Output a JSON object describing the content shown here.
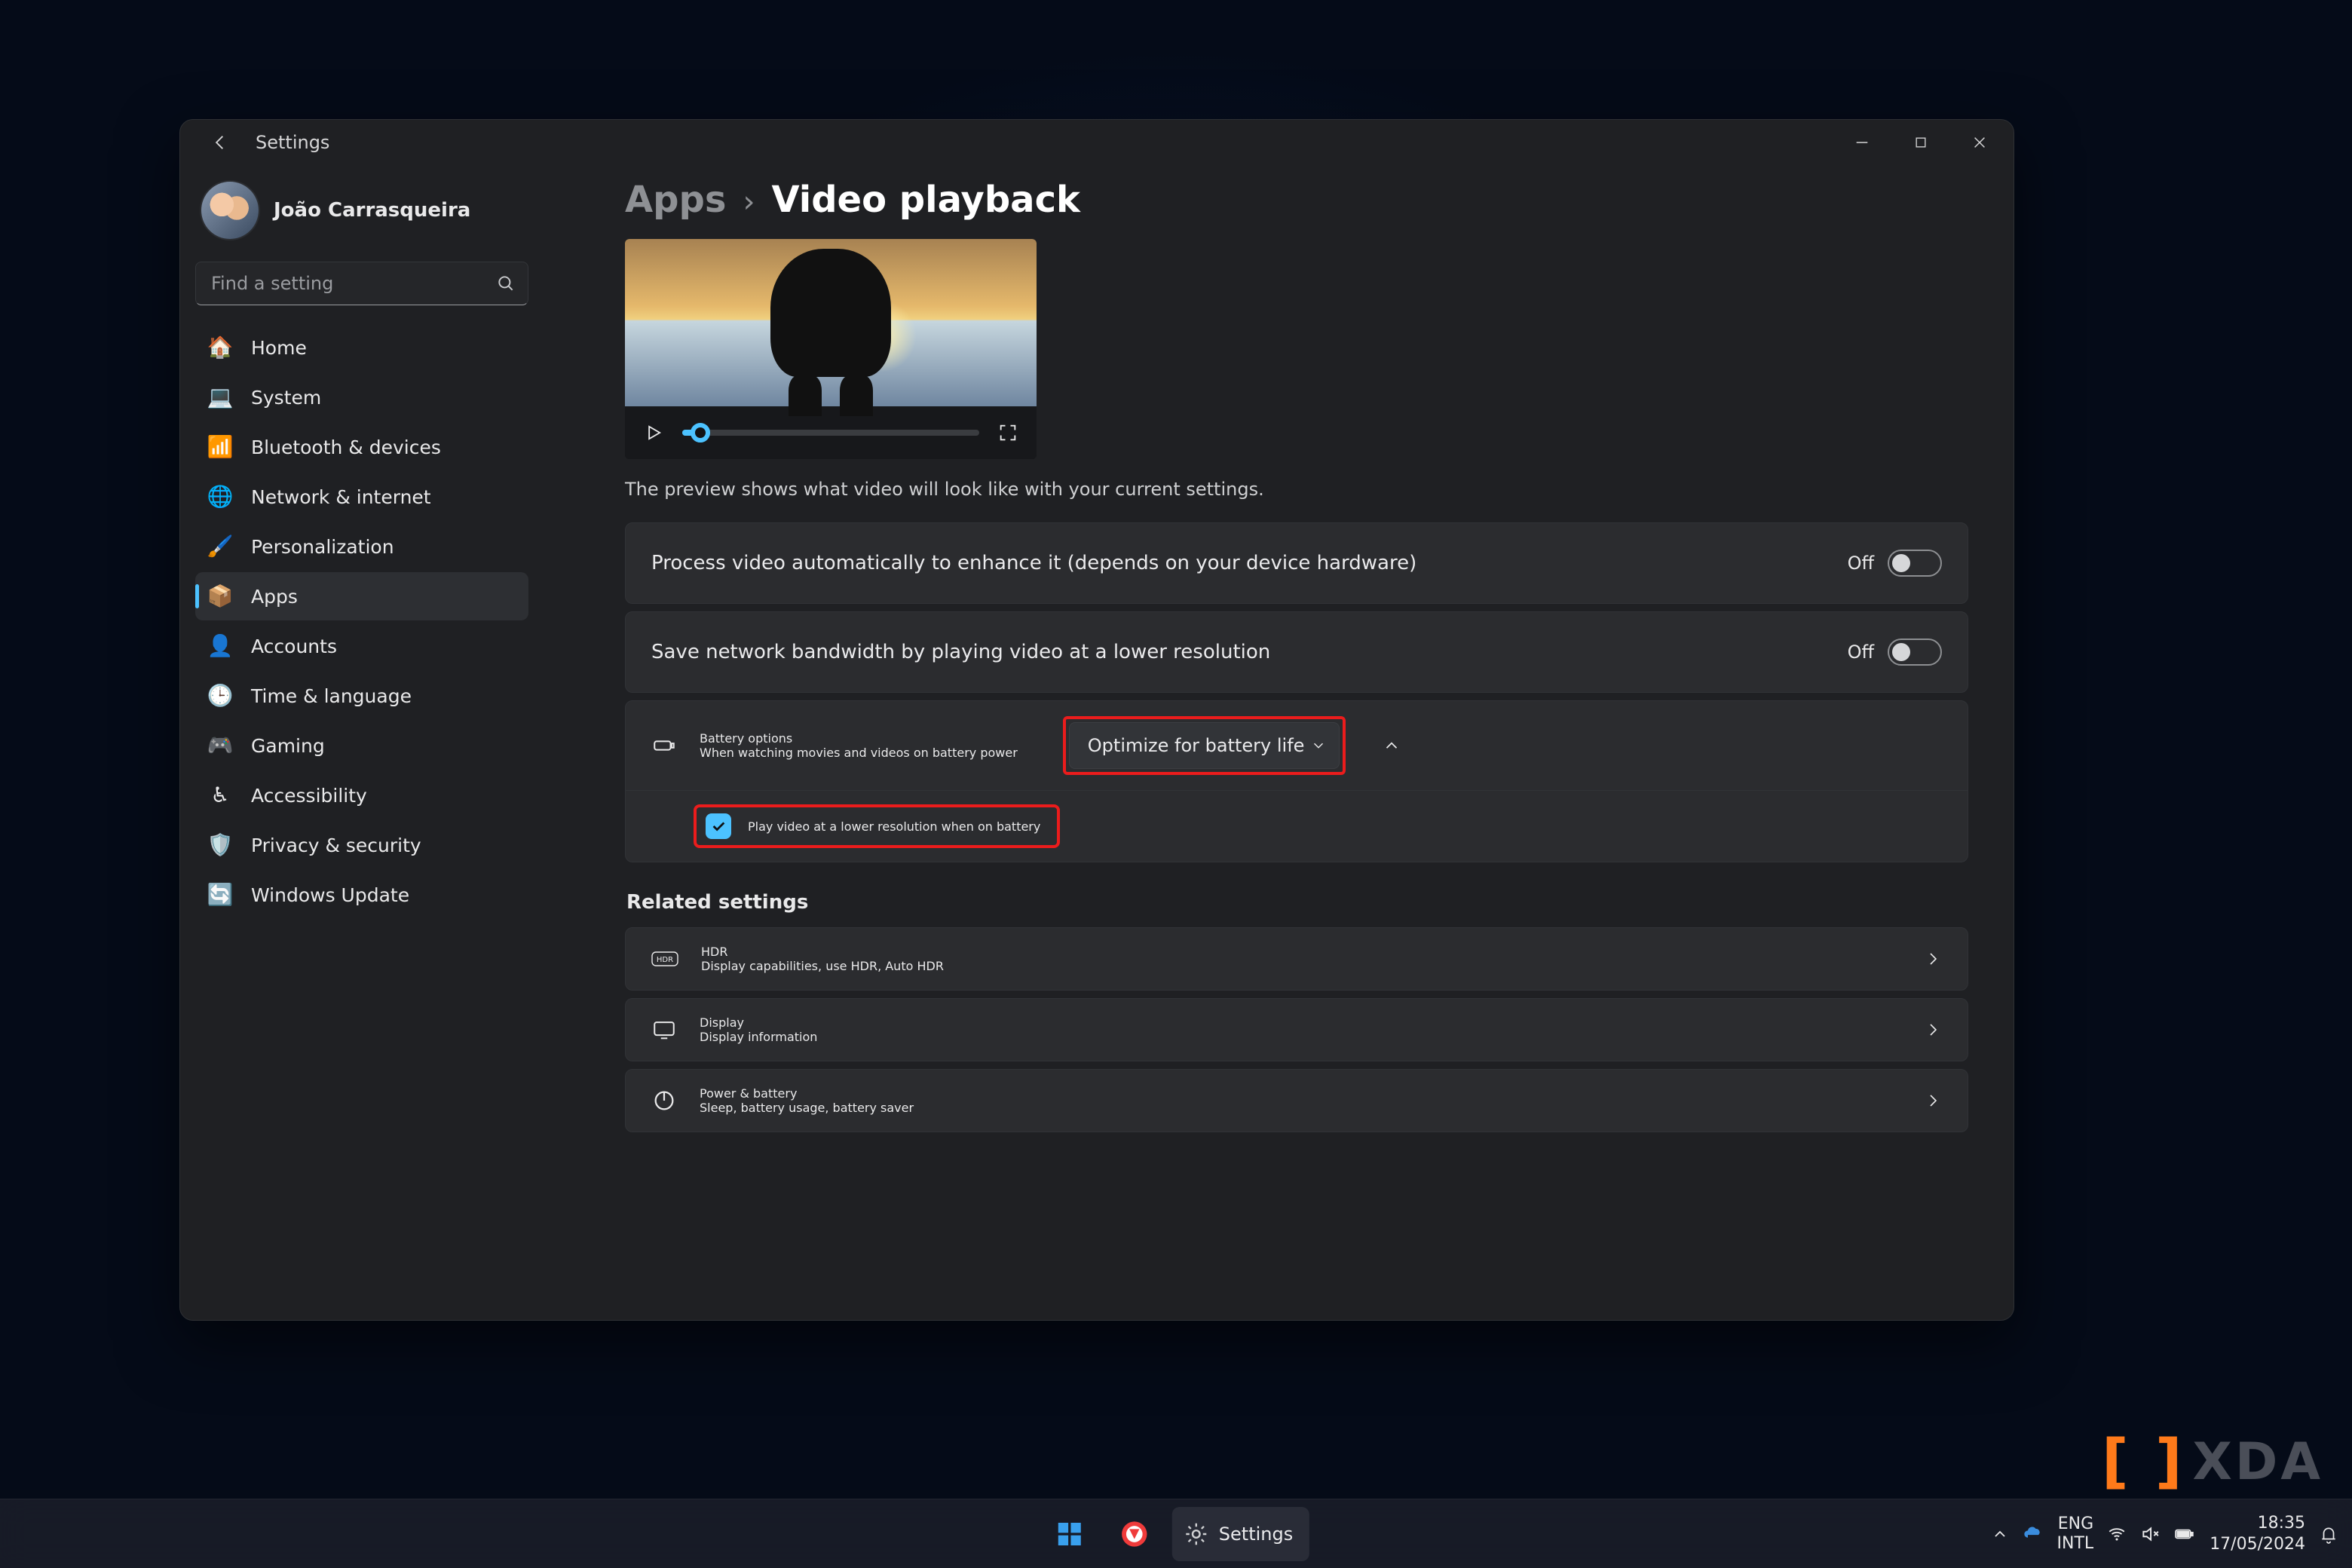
{
  "window": {
    "app_title": "Settings",
    "profile_name": "João Carrasqueira",
    "search_placeholder": "Find a setting"
  },
  "sidebar": {
    "items": [
      {
        "label": "Home",
        "emoji": "🏠"
      },
      {
        "label": "System",
        "emoji": "💻"
      },
      {
        "label": "Bluetooth & devices",
        "emoji": "📶"
      },
      {
        "label": "Network & internet",
        "emoji": "🌐"
      },
      {
        "label": "Personalization",
        "emoji": "🖌️"
      },
      {
        "label": "Apps",
        "emoji": "📦"
      },
      {
        "label": "Accounts",
        "emoji": "👤"
      },
      {
        "label": "Time & language",
        "emoji": "🕒"
      },
      {
        "label": "Gaming",
        "emoji": "🎮"
      },
      {
        "label": "Accessibility",
        "emoji": "♿"
      },
      {
        "label": "Privacy & security",
        "emoji": "🛡️"
      },
      {
        "label": "Windows Update",
        "emoji": "🔄"
      }
    ],
    "active_index": 5
  },
  "main": {
    "breadcrumb_parent": "Apps",
    "breadcrumb_current": "Video playback",
    "preview_caption": "The preview shows what video will look like with your current settings.",
    "toggles": [
      {
        "label": "Process video automatically to enhance it (depends on your device hardware)",
        "state": "Off"
      },
      {
        "label": "Save network bandwidth by playing video at a lower resolution",
        "state": "Off"
      }
    ],
    "battery": {
      "title": "Battery options",
      "subtitle": "When watching movies and videos on battery power",
      "dropdown_value": "Optimize for battery life",
      "checkbox_label": "Play video at a lower resolution when on battery",
      "checkbox_checked": true
    },
    "related_heading": "Related settings",
    "related": [
      {
        "title": "HDR",
        "subtitle": "Display capabilities, use HDR, Auto HDR",
        "icon": "hdr"
      },
      {
        "title": "Display",
        "subtitle": "Display information",
        "icon": "display"
      },
      {
        "title": "Power & battery",
        "subtitle": "Sleep, battery usage, battery saver",
        "icon": "power"
      }
    ]
  },
  "taskbar": {
    "running_app_label": "Settings",
    "lang_top": "ENG",
    "lang_bottom": "INTL",
    "time": "18:35",
    "date": "17/05/2024"
  },
  "watermark": {
    "text": "XDA"
  }
}
